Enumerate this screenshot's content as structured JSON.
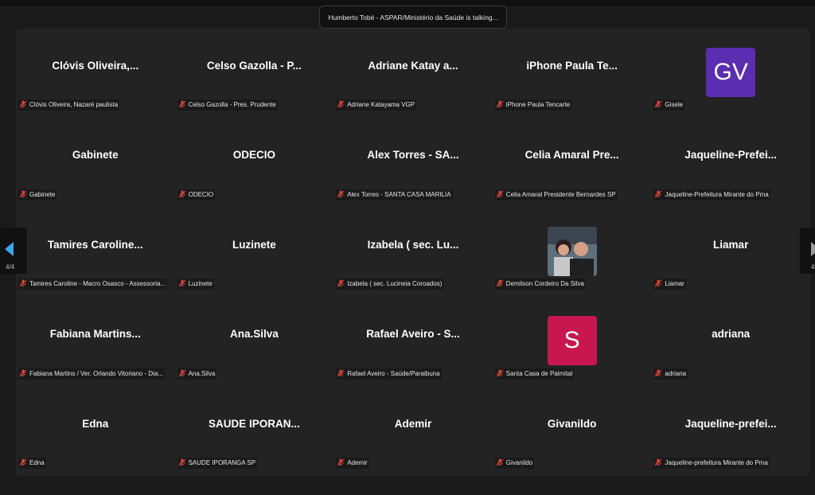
{
  "talking_indicator": "Humberto Tobé - ASPAR/Ministério da Saúde is talking...",
  "pagination": {
    "left_page": "4/4",
    "right_page": "4"
  },
  "colors": {
    "mic_muted": "#e0463a",
    "nav_active": "#3ea6e8"
  },
  "participants": [
    {
      "display": "Clóvis Oliveira,...",
      "label": "Clóvis Oliveira, Nazaré paulista"
    },
    {
      "display": "Celso Gazolla - P...",
      "label": "Celso Gazolla - Pres. Prudente"
    },
    {
      "display": "Adriane Katay a...",
      "label": "Adriane Katayama VGP"
    },
    {
      "display": "iPhone Paula  Te...",
      "label": "iPhone Paula  Tencarte"
    },
    {
      "avatar": "GV",
      "avatar_color": "#5b2db0",
      "label": "Gisele"
    },
    {
      "display": "Gabinete",
      "label": "Gabinete"
    },
    {
      "display": "ODECIO",
      "label": "ODECIO"
    },
    {
      "display": "Alex Torres - SA...",
      "label": "Alex Torres - SANTA CASA MARILIA"
    },
    {
      "display": "Celia Amaral Pre...",
      "label": "Celia Amaral Presidente Bernardes SP"
    },
    {
      "display": "Jaqueline-Prefei...",
      "label": "Jaqueline-Prefeitura Mirante do Pma"
    },
    {
      "display": "Tamires Caroline...",
      "label": "Tamires Caroline - Macro Osasco - Assessoria..."
    },
    {
      "display": "Luzinete",
      "label": "Luzinete"
    },
    {
      "display": "Izabela ( sec. Lu...",
      "label": "Izabela ( sec. Lucineia Coroados)"
    },
    {
      "avatar_photo": true,
      "label": "Demilson Cordeiro Da Silva"
    },
    {
      "display": "Liamar",
      "label": "Liamar"
    },
    {
      "display": "Fabiana Martins...",
      "label": "Fabiana Martins / Ver. Orlando Vitoriano - Dia..."
    },
    {
      "display": "Ana.Silva",
      "label": "Ana.Silva"
    },
    {
      "display": "Rafael Aveiro - S...",
      "label": "Rafael Aveiro - Saúde/Paraibuna"
    },
    {
      "avatar": "S",
      "avatar_color": "#c8174f",
      "label": "Santa Casa de Palmital"
    },
    {
      "display": "adriana",
      "label": "adriana"
    },
    {
      "display": "Edna",
      "label": "Edna"
    },
    {
      "display": "SAUDE IPORAN...",
      "label": "SAUDE IPORANGA SP"
    },
    {
      "display": "Ademir",
      "label": "Ademir"
    },
    {
      "display": "Givanildo",
      "label": "Givanildo"
    },
    {
      "display": "Jaqueline-prefei...",
      "label": "Jaqueline-prefeitura Mirante do Pma"
    }
  ]
}
